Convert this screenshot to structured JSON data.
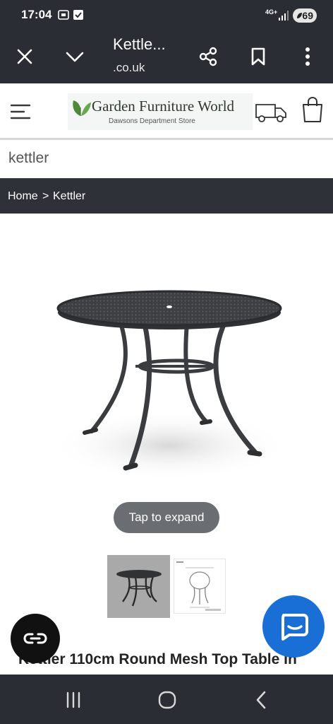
{
  "status_bar": {
    "time": "17:04",
    "network": "4G+",
    "battery": "69"
  },
  "browser": {
    "title": "Kettle...",
    "url": ".co.uk"
  },
  "site": {
    "logo_name": "Garden Furniture World",
    "logo_sub": "Dawsons Department Store"
  },
  "search": {
    "value": "kettler"
  },
  "breadcrumb": {
    "home": "Home",
    "separator": ">",
    "current": "Kettler"
  },
  "product": {
    "expand_label": "Tap to expand",
    "title": "Kettler 110cm Round Mesh Top Table In"
  },
  "colors": {
    "dark_bar": "#2a2d33",
    "chat_blue": "#1a6fd6"
  }
}
